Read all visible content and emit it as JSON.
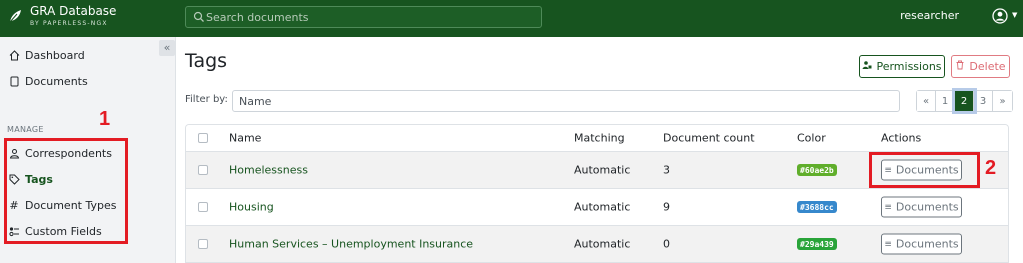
{
  "header": {
    "app_title": "GRA Database",
    "app_subtitle": "BY PAPERLESS-NGX",
    "search_placeholder": "Search documents",
    "username": "researcher"
  },
  "sidebar": {
    "top_items": [
      {
        "label": "Dashboard",
        "icon": "house-icon"
      },
      {
        "label": "Documents",
        "icon": "files-icon"
      }
    ],
    "section_label": "MANAGE",
    "manage_items": [
      {
        "label": "Correspondents",
        "icon": "person-icon"
      },
      {
        "label": "Tags",
        "icon": "tag-icon",
        "active": true
      },
      {
        "label": "Document Types",
        "icon": "hash-icon"
      },
      {
        "label": "Custom Fields",
        "icon": "ui-radios-icon"
      }
    ]
  },
  "page": {
    "title": "Tags",
    "permissions_label": "Permissions",
    "delete_label": "Delete",
    "filter_label": "Filter by:",
    "filter_placeholder": "Name"
  },
  "pagination": [
    "«",
    "1",
    "2",
    "3",
    "»"
  ],
  "pagination_active": "2",
  "table": {
    "columns": [
      "Name",
      "Matching",
      "Document count",
      "Color",
      "Actions"
    ],
    "rows": [
      {
        "name": "Homelessness",
        "matching": "Automatic",
        "count": "3",
        "color": "#60ae2b",
        "action": "Documents"
      },
      {
        "name": "Housing",
        "matching": "Automatic",
        "count": "9",
        "color": "#3688cc",
        "action": "Documents"
      },
      {
        "name": "Human Services – Unemployment Insurance",
        "matching": "Automatic",
        "count": "0",
        "color": "#29a439",
        "action": "Documents"
      }
    ]
  },
  "annotations": {
    "label_1": "1",
    "label_2": "2",
    "color": "#e31b23"
  },
  "colors": {
    "brand": "#17541f",
    "danger": "#dc6b74"
  }
}
